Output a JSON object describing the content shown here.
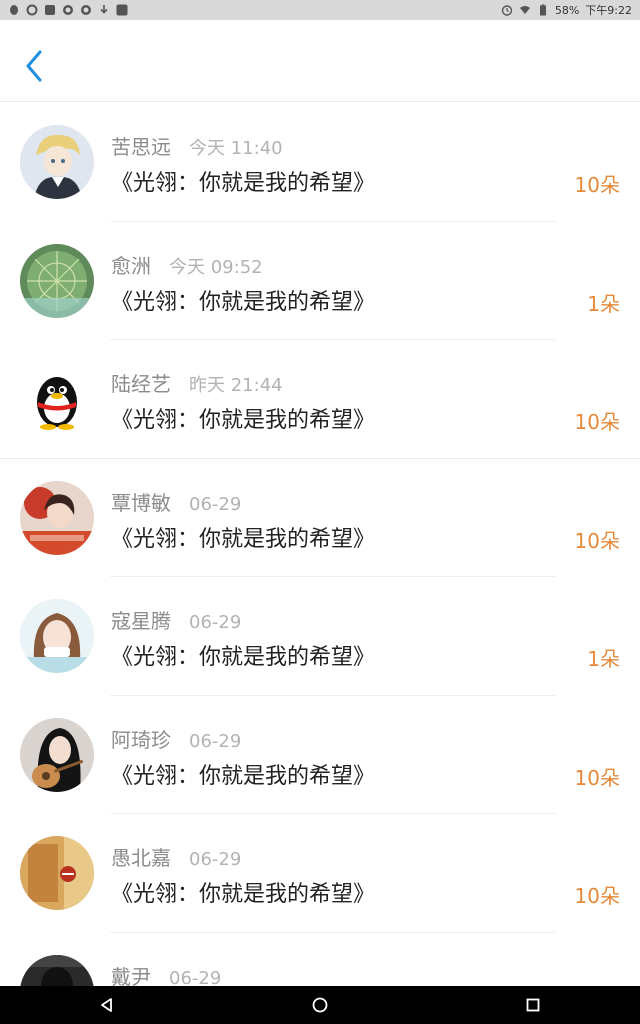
{
  "status_bar": {
    "battery": "58%",
    "time": "下午9:22"
  },
  "header": {
    "back_icon": "chevron-left-icon",
    "accent_color": "#1e8fe1"
  },
  "list": {
    "items": [
      {
        "name": "苦思远",
        "time": "今天 11:40",
        "title": "《光翎：你就是我的希望》",
        "count": "10朵",
        "avatar": "anime-boy"
      },
      {
        "name": "愈洲",
        "time": "今天 09:52",
        "title": "《光翎：你就是我的希望》",
        "count": "1朵",
        "avatar": "cactus"
      },
      {
        "name": "陆经艺",
        "time": "昨天 21:44",
        "title": "《光翎：你就是我的希望》",
        "count": "10朵",
        "avatar": "qq-penguin"
      },
      {
        "name": "覃博敏",
        "time": "06-29",
        "title": "《光翎：你就是我的希望》",
        "count": "10朵",
        "avatar": "red-girl"
      },
      {
        "name": "寇星腾",
        "time": "06-29",
        "title": "《光翎：你就是我的希望》",
        "count": "1朵",
        "avatar": "girl-face"
      },
      {
        "name": "阿琦珍",
        "time": "06-29",
        "title": "《光翎：你就是我的希望》",
        "count": "10朵",
        "avatar": "guitar-girl"
      },
      {
        "name": "愚北嘉",
        "time": "06-29",
        "title": "《光翎：你就是我的希望》",
        "count": "10朵",
        "avatar": "street-wall"
      },
      {
        "name": "戴尹",
        "time": "06-29",
        "title": "",
        "count": "",
        "avatar": "dark-person"
      }
    ]
  },
  "colors": {
    "count": "#e58a3b",
    "name": "#8c8c8c",
    "time": "#b3b3b3"
  }
}
